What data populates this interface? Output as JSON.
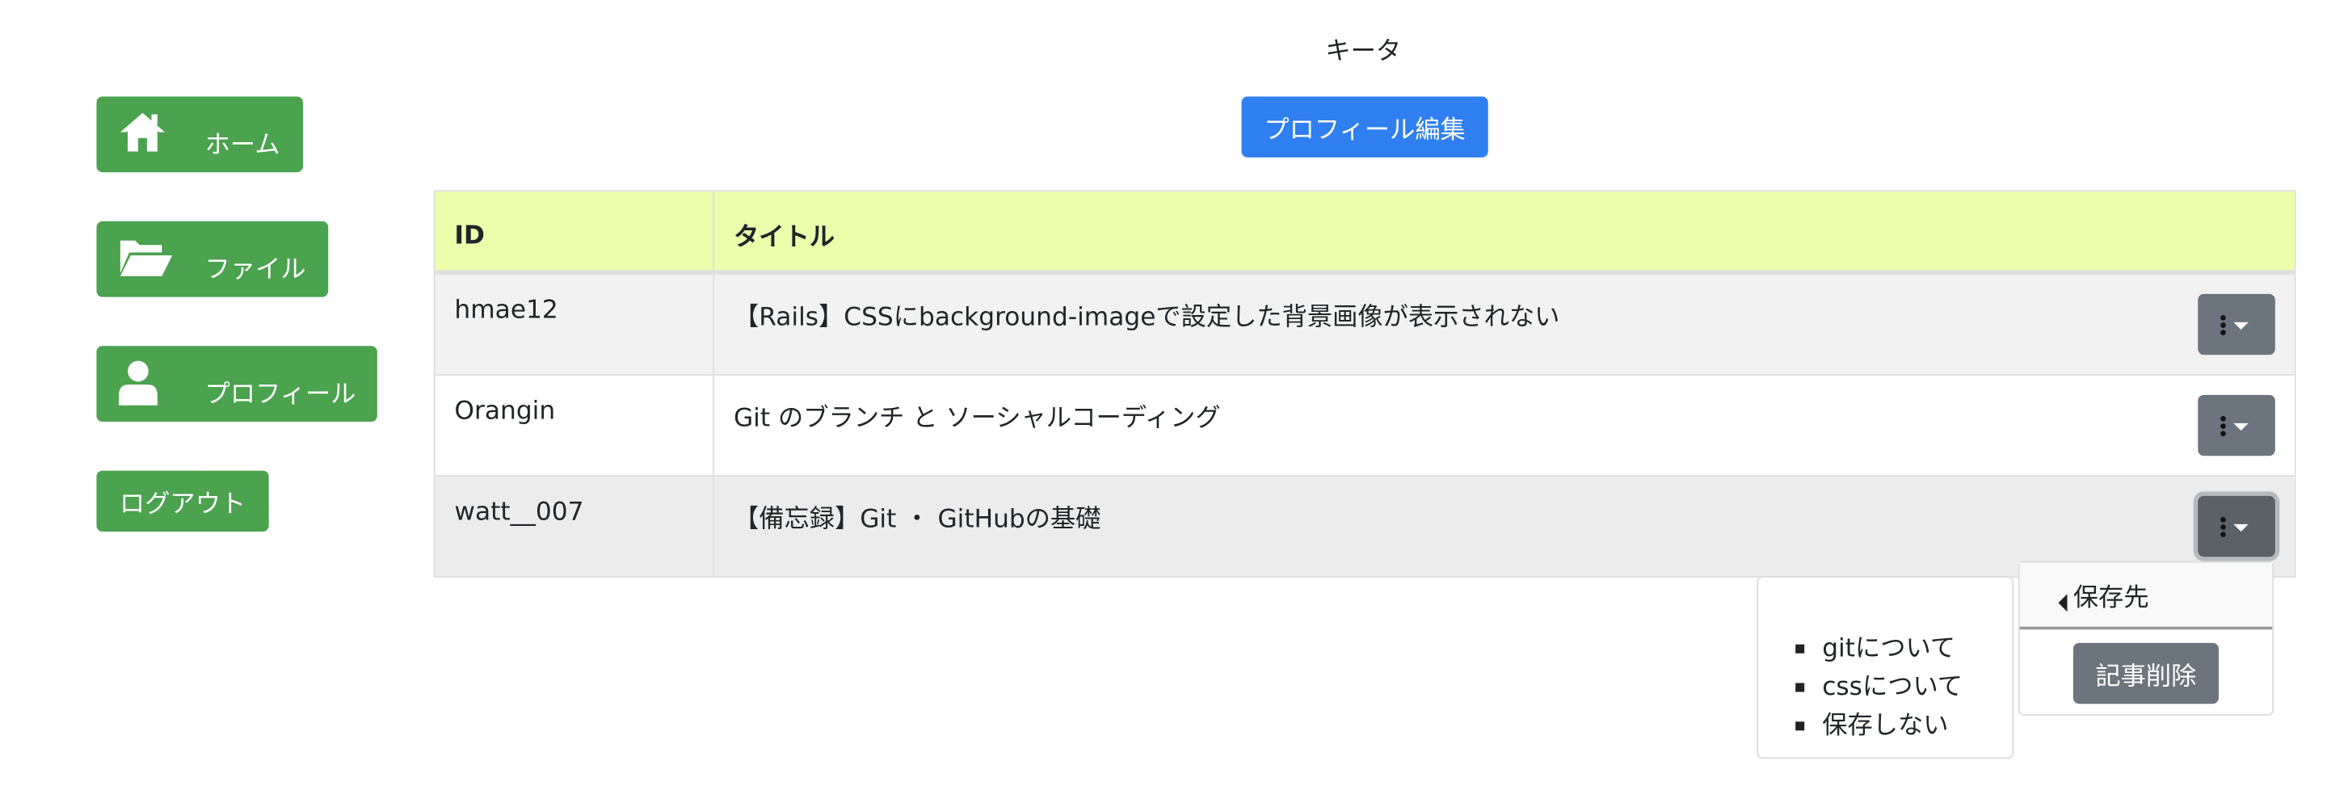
{
  "app": {
    "title": "キータ",
    "edit_profile_label": "プロフィール編集"
  },
  "sidebar": {
    "items": [
      {
        "label": "ホーム",
        "icon": "home-icon"
      },
      {
        "label": "ファイル",
        "icon": "folder-open-icon"
      },
      {
        "label": "プロフィール",
        "icon": "user-icon"
      }
    ],
    "logout_label": "ログアウト"
  },
  "table": {
    "columns": [
      "ID",
      "タイトル"
    ],
    "rows": [
      {
        "id": "hmae12",
        "title": "【Rails】CSSにbackground-imageで設定した背景画像が表示されない"
      },
      {
        "id": "Orangin",
        "title": "Git のブランチ と ソーシャルコーディング"
      },
      {
        "id": "watt__007",
        "title": "【備忘録】Git ・ GitHubの基礎"
      }
    ]
  },
  "dropdown": {
    "save_label": "保存先",
    "delete_label": "記事削除",
    "folders": [
      "gitについて",
      "cssについて",
      "保存しない"
    ]
  },
  "colors": {
    "primary": "#2f7ff0",
    "success": "#4ba24f",
    "secondary": "#6c757d",
    "header_bg": "#ecfdac"
  }
}
